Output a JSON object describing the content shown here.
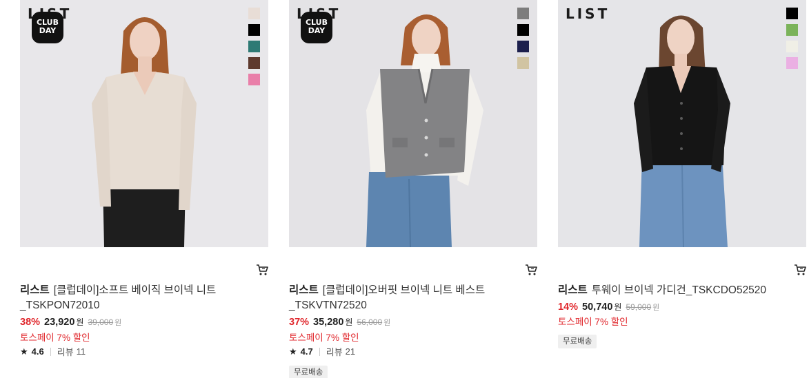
{
  "products": [
    {
      "logo": "LIST",
      "club_badge": [
        "CLUB",
        "DAY"
      ],
      "swatches": [
        "#e8ddd6",
        "#000000",
        "#2e7a75",
        "#5e3a2e",
        "#e97fa9"
      ],
      "brand": "리스트",
      "title": "[클럽데이]소프트 베이직 브이넥 니트_TSKPON72010",
      "discount": "38%",
      "price": "23,920",
      "price_unit": "원",
      "original_price": "39,000",
      "original_unit": "원",
      "toss": "토스페이 7% 할인",
      "rating": "4.6",
      "review_label": "리뷰",
      "review_count": "11",
      "free_shipping": ""
    },
    {
      "logo": "LIST",
      "club_badge": [
        "CLUB",
        "DAY"
      ],
      "swatches": [
        "#7d7d7d",
        "#000000",
        "#1c1f4d",
        "#d1c4a2"
      ],
      "brand": "리스트",
      "title": "[클럽데이]오버핏 브이넥 니트 베스트_TSKVTN72520",
      "discount": "37%",
      "price": "35,280",
      "price_unit": "원",
      "original_price": "56,000",
      "original_unit": "원",
      "toss": "토스페이 7% 할인",
      "rating": "4.7",
      "review_label": "리뷰",
      "review_count": "21",
      "free_shipping": "무료배송"
    },
    {
      "logo": "LIST",
      "club_badge": [],
      "swatches": [
        "#000000",
        "#7bb35a",
        "#f0efe6",
        "#ebb0e3"
      ],
      "brand": "리스트",
      "title": "투웨이 브이넥 가디건_TSKCDO52520",
      "discount": "14%",
      "price": "50,740",
      "price_unit": "원",
      "original_price": "59,000",
      "original_unit": "원",
      "toss": "토스페이 7% 할인",
      "rating": "",
      "review_label": "",
      "review_count": "",
      "free_shipping": "무료배송"
    }
  ],
  "icons": {
    "cart": "cart-icon",
    "star": "star-icon"
  },
  "colors": {
    "discount": "#e0262b",
    "toss": "#e0262b",
    "badge_bg": "#efefef"
  }
}
